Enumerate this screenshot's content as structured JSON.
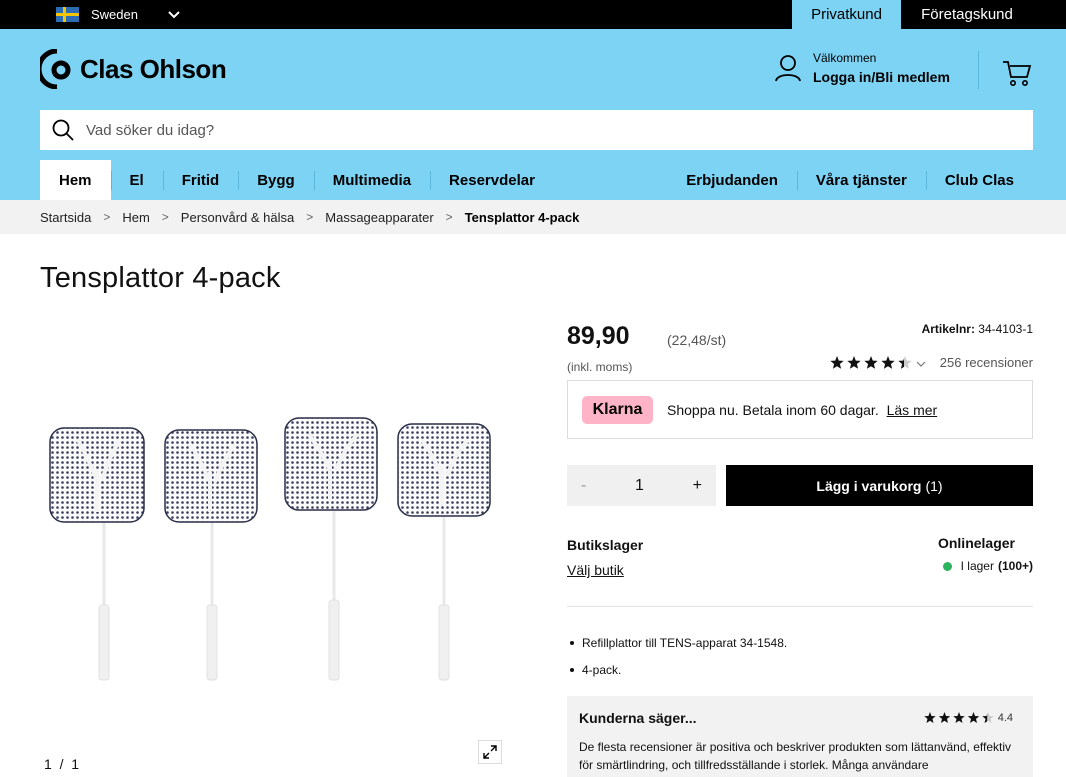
{
  "topbar": {
    "country": "Sweden",
    "segment_private": "Privatkund",
    "segment_business": "Företagskund"
  },
  "header": {
    "logo": "Clas Ohlson",
    "welcome": "Välkommen",
    "login": "Logga in/Bli medlem",
    "search_placeholder": "Vad söker du idag?"
  },
  "nav": {
    "items": [
      "Hem",
      "El",
      "Fritid",
      "Bygg",
      "Multimedia",
      "Reservdelar"
    ],
    "right_items": [
      "Erbjudanden",
      "Våra tjänster",
      "Club Clas"
    ]
  },
  "breadcrumb": [
    "Startsida",
    "Hem",
    "Personvård & hälsa",
    "Massageapparater",
    "Tensplattor 4-pack"
  ],
  "product": {
    "title": "Tensplattor 4-pack",
    "price": "89,90",
    "unit_price": "(22,48/st)",
    "vat": "(inkl. moms)",
    "sku_label": "Artikelnr:",
    "sku": "34-4103-1",
    "rating": 4.4,
    "reviews": "256 recensioner",
    "image_pager": "1  /  1"
  },
  "klarna": {
    "badge": "Klarna",
    "text": "Shoppa nu. Betala inom 60 dagar.",
    "link": "Läs mer"
  },
  "purchase": {
    "minus": "-",
    "quantity": "1",
    "plus": "+",
    "add_to_cart": "Lägg i varukorg",
    "add_count": "(1)"
  },
  "availability": {
    "store_label": "Butikslager",
    "store_link": "Välj butik",
    "online_label": "Onlinelager",
    "online_status": "I lager",
    "online_qty": "(100+)",
    "status_color": "#2db35d"
  },
  "features": [
    "Refillplattor till TENS-apparat 34-1548.",
    "4-pack."
  ],
  "summary": {
    "title": "Kunderna säger...",
    "rating": "4.4",
    "text": "De flesta recensioner är positiva och beskriver produkten som lättanvänd, effektiv för smärtlindring, och tillfredsställande i storlek. Många användare"
  },
  "colors": {
    "brand_blue": "#7dd3f4",
    "klarna_pink": "#ffb3c7"
  }
}
